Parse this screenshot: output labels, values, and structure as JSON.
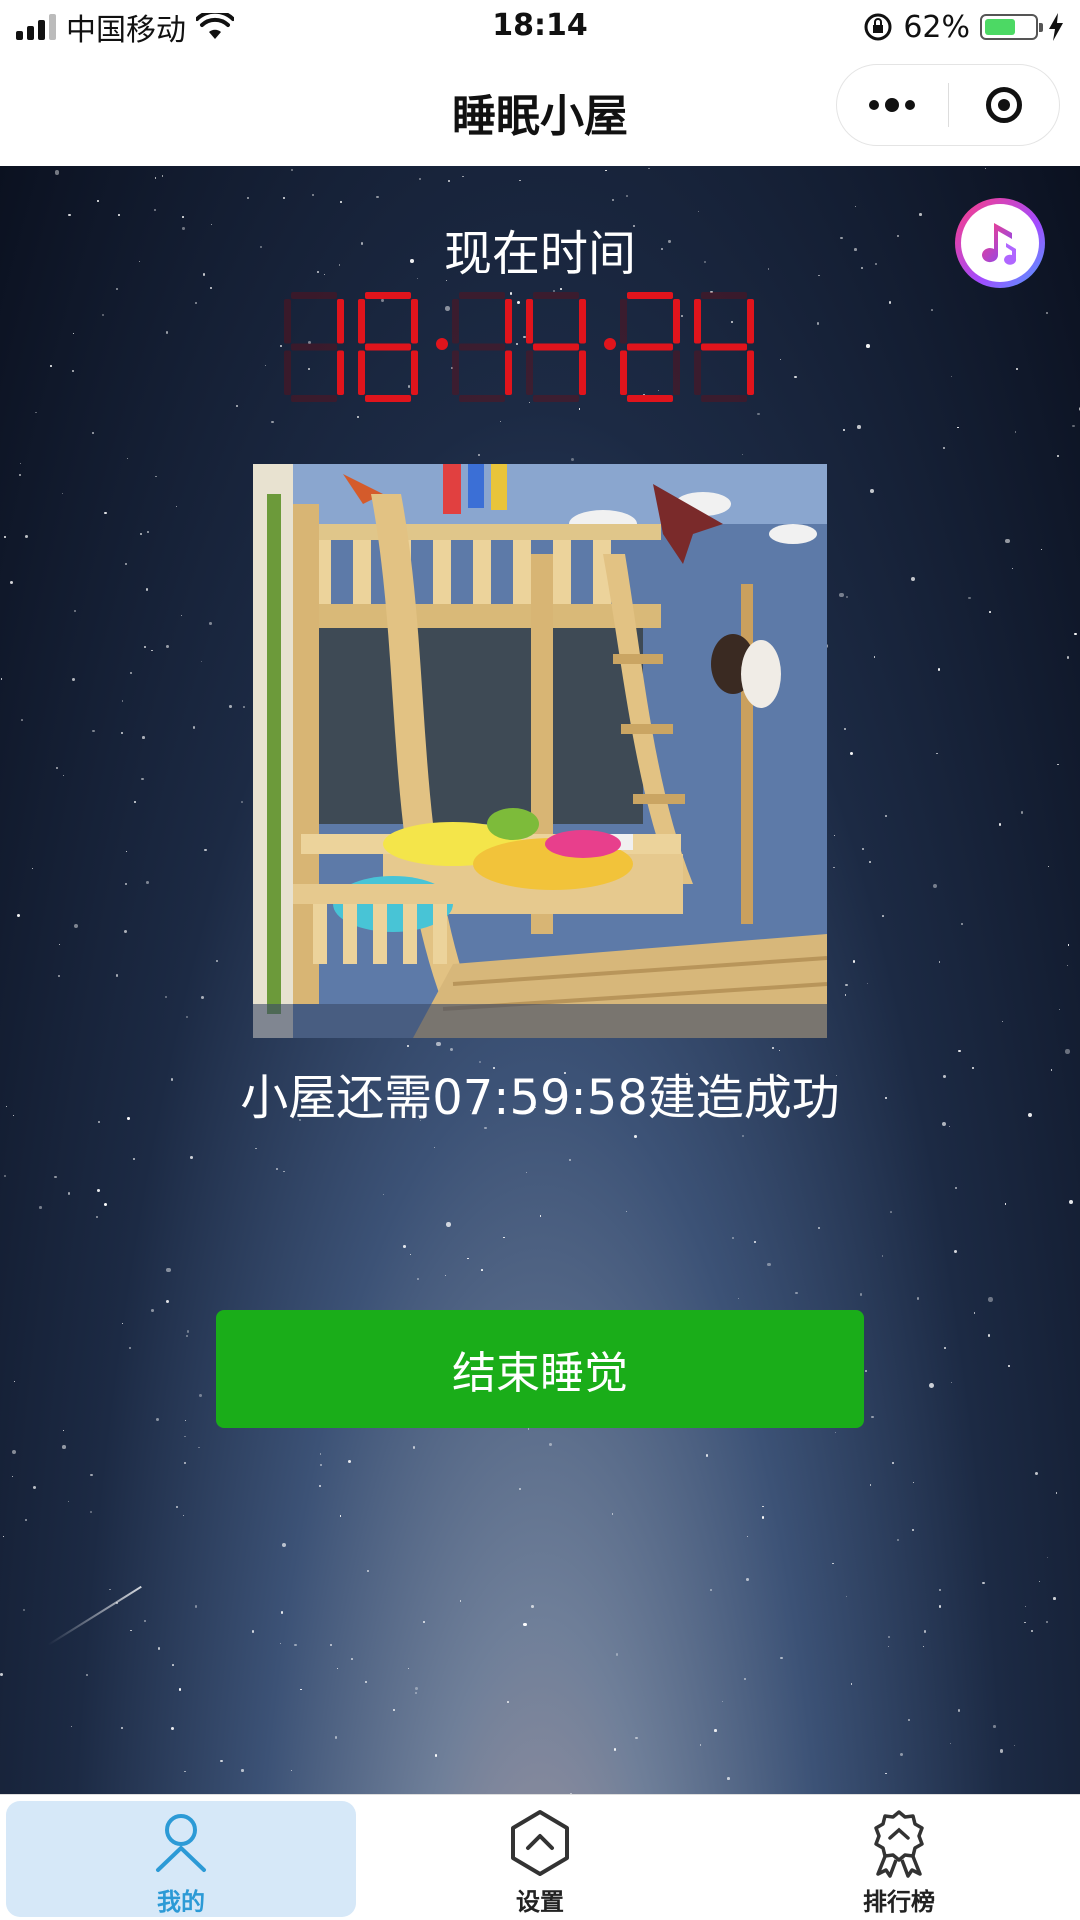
{
  "status_bar": {
    "carrier": "中国移动",
    "time": "18:14",
    "battery_percent": "62%",
    "battery_level": 0.62
  },
  "nav": {
    "title": "睡眠小屋",
    "more_icon": "more-dots-icon",
    "close_icon": "target-circle-icon"
  },
  "main": {
    "now_label": "现在时间",
    "clock": "18:14:24",
    "remaining_text": "小屋还需07:59:58建造成功",
    "end_button_label": "结束睡觉",
    "music_icon": "music-note-icon"
  },
  "tabs": [
    {
      "label": "我的",
      "icon": "user-icon",
      "active": true
    },
    {
      "label": "设置",
      "icon": "hexagon-chevron-icon",
      "active": false
    },
    {
      "label": "排行榜",
      "icon": "medal-icon",
      "active": false
    }
  ],
  "colors": {
    "accent_green": "#1aad19",
    "active_tab": "#2c9ad6",
    "clock_red": "#e0141c"
  }
}
